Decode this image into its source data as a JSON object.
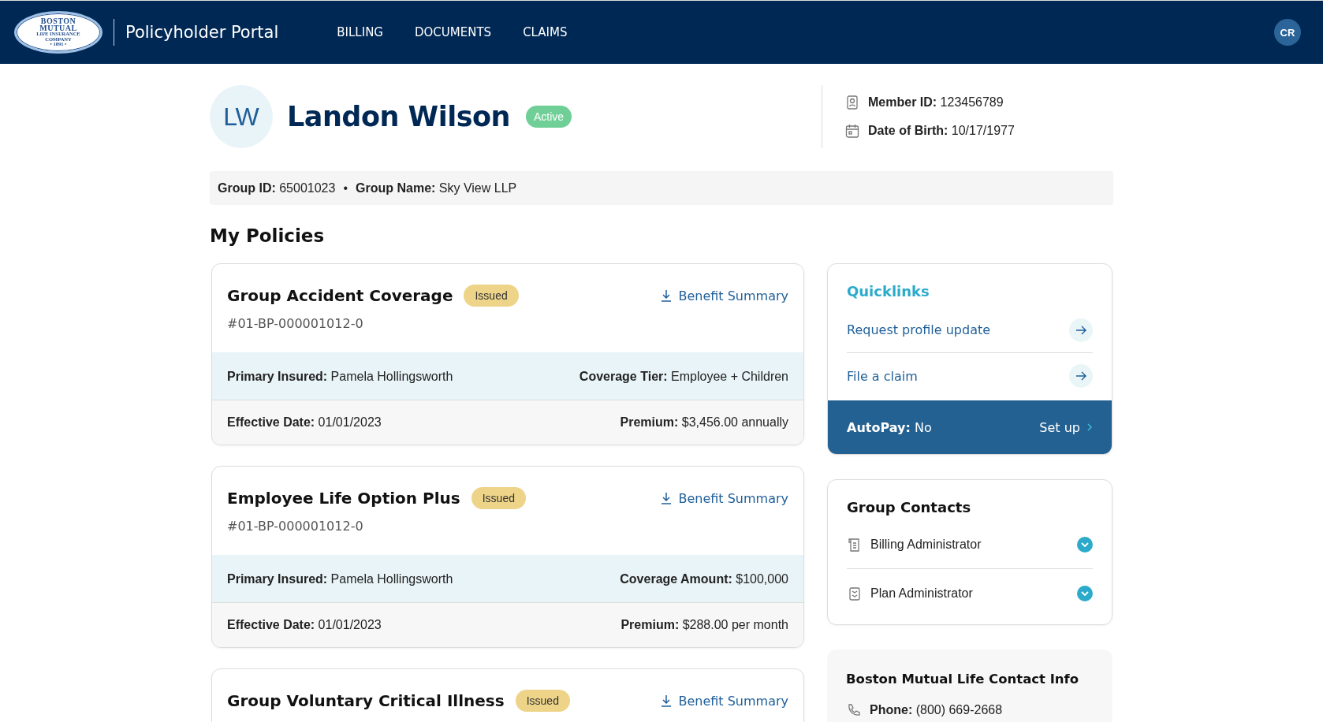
{
  "header": {
    "logo_lines": [
      "BOSTON",
      "MUTUAL",
      "LIFE INSURANCE",
      "COMPANY",
      "• 1891 •"
    ],
    "title": "Policyholder Portal",
    "nav": [
      {
        "label": "BILLING"
      },
      {
        "label": "DOCUMENTS"
      },
      {
        "label": "CLAIMS"
      }
    ],
    "user_initials": "CR"
  },
  "profile": {
    "initials": "LW",
    "name": "Landon Wilson",
    "status": "Active",
    "details": [
      {
        "kind": "id",
        "label": "Member ID:",
        "value": "123456789"
      },
      {
        "kind": "date",
        "label": "Date of Birth:",
        "value": "10/17/1977"
      }
    ]
  },
  "group_bar": {
    "items": [
      {
        "label": "Group ID:",
        "value": "65001023"
      },
      {
        "label": "Group Name:",
        "value": "Sky View LLP"
      }
    ],
    "separator": "•"
  },
  "policies_heading": "My Policies",
  "policies": [
    {
      "title": "Group Accident Coverage",
      "status": "Issued",
      "number": "#01-BP-000001012-0",
      "link": "Benefit Summary",
      "rows": [
        [
          {
            "label": "Primary Insured:",
            "value": "Pamela Hollingsworth"
          },
          {
            "label": "Coverage Tier:",
            "value": "Employee + Children"
          }
        ],
        [
          {
            "label": "Effective Date:",
            "value": "01/01/2023"
          },
          {
            "label": "Premium:",
            "value": "$3,456.00 annually"
          }
        ]
      ]
    },
    {
      "title": "Employee Life Option Plus",
      "status": "Issued",
      "number": "#01-BP-000001012-0",
      "link": "Benefit Summary",
      "rows": [
        [
          {
            "label": "Primary Insured:",
            "value": "Pamela Hollingsworth"
          },
          {
            "label": "Coverage Amount:",
            "value": "$100,000"
          }
        ],
        [
          {
            "label": "Effective Date:",
            "value": "01/01/2023"
          },
          {
            "label": "Premium:",
            "value": "$288.00 per month"
          }
        ]
      ]
    },
    {
      "title": "Group Voluntary Critical Illness",
      "status": "Issued",
      "link": "Benefit Summary"
    }
  ],
  "quicklinks": {
    "title": "Quicklinks",
    "links": [
      {
        "label": "Request profile update"
      },
      {
        "label": "File a claim"
      }
    ],
    "autopay": {
      "label": "AutoPay:",
      "value": "No",
      "action": "Set up"
    }
  },
  "group_contacts": {
    "title": "Group Contacts",
    "items": [
      {
        "kind": "billing",
        "label": "Billing Administrator",
        "expanded": false
      },
      {
        "kind": "plan",
        "label": "Plan Administrator",
        "expanded": false
      }
    ]
  },
  "contact_info": {
    "title": "Boston Mutual Life Contact Info",
    "items": [
      {
        "kind": "phone",
        "label": "Phone:",
        "value": "(800) 669-2668"
      }
    ]
  }
}
